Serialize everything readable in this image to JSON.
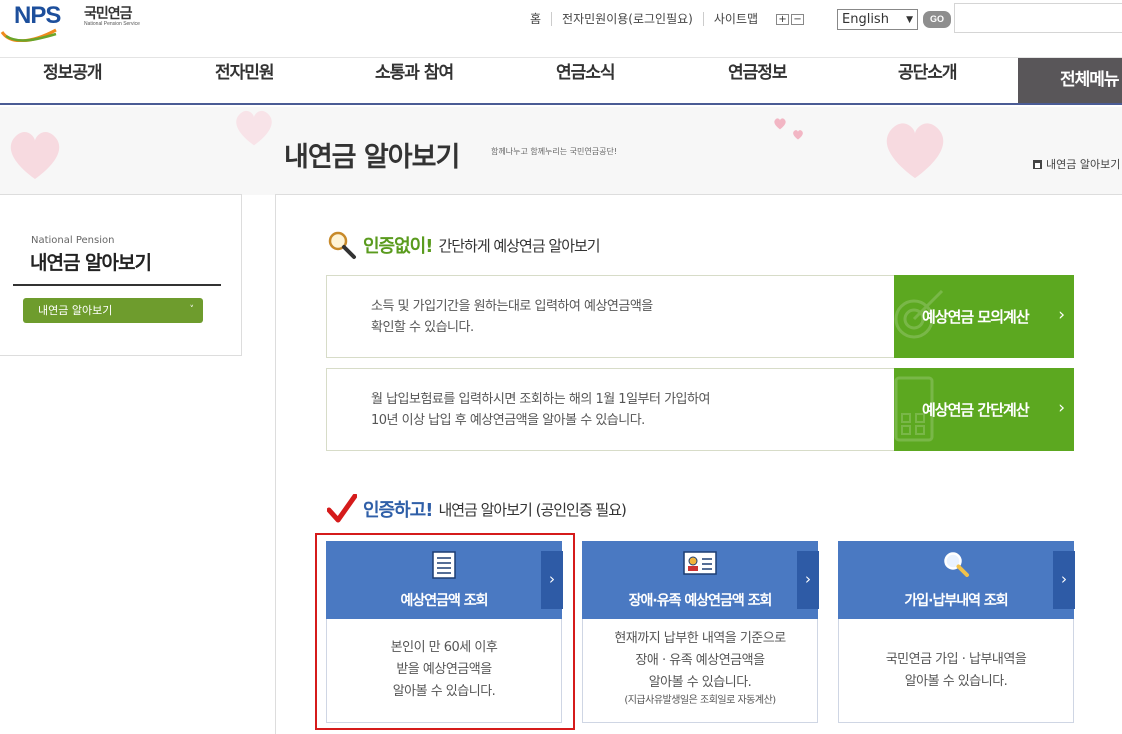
{
  "header": {
    "logo_text": "NPS",
    "logo_kr": "국민연금",
    "logo_en": "National Pension Service",
    "util_links": [
      "홈",
      "전자민원이용(로그인필요)",
      "사이트맵"
    ],
    "zoom_in": "+",
    "zoom_out": "−",
    "language_selected": "English",
    "go_label": "GO"
  },
  "gnb": {
    "items": [
      "정보공개",
      "전자민원",
      "소통과 참여",
      "연금소식",
      "연금정보",
      "공단소개"
    ],
    "all_menu": "전체메뉴"
  },
  "visual": {
    "title": "내연금 알아보기",
    "subtitle": "함께나누고 함께누리는 국민연금공단!",
    "breadcrumb": "내연금 알아보기"
  },
  "lnb": {
    "en": "National Pension",
    "title": "내연금 알아보기",
    "selected": "내연금 알아보기"
  },
  "section1": {
    "strong": "인증없이!",
    "sub": "간단하게 예상연금 알아보기",
    "calc1": {
      "line1": "소득 및 가입기간을 원하는대로 입력하여 예상연금액을",
      "line2": "확인할 수 있습니다.",
      "button": "예상연금 모의계산"
    },
    "calc2": {
      "line1": "월 납입보험료를 입력하시면 조회하는 해의 1월 1일부터 가입하여",
      "line2": "10년 이상 납입 후 예상연금액을 알아볼 수 있습니다.",
      "button": "예상연금 간단계산"
    }
  },
  "section2": {
    "strong": "인증하고!",
    "sub": "내연금 알아보기 (공인인증 필요)",
    "cards": [
      {
        "title": "예상연금액 조회",
        "lines": [
          "본인이 만 60세 이후",
          "받을 예상연금액을",
          "알아볼 수 있습니다."
        ]
      },
      {
        "title": "장애·유족 예상연금액 조회",
        "lines": [
          "현재까지 납부한 내역을 기준으로",
          "장애 · 유족 예상연금액을",
          "알아볼 수 있습니다."
        ],
        "note": "(지급사유발생일은 조회일로 자동계산)"
      },
      {
        "title": "가입·납부내역 조회",
        "lines": [
          "국민연금 가입 · 납부내역을",
          "알아볼 수 있습니다."
        ]
      }
    ]
  },
  "colors": {
    "brand_blue": "#1d4f9c",
    "green": "#5ca820",
    "card_blue": "#4a79c2",
    "highlight_red": "#d51b1b"
  }
}
